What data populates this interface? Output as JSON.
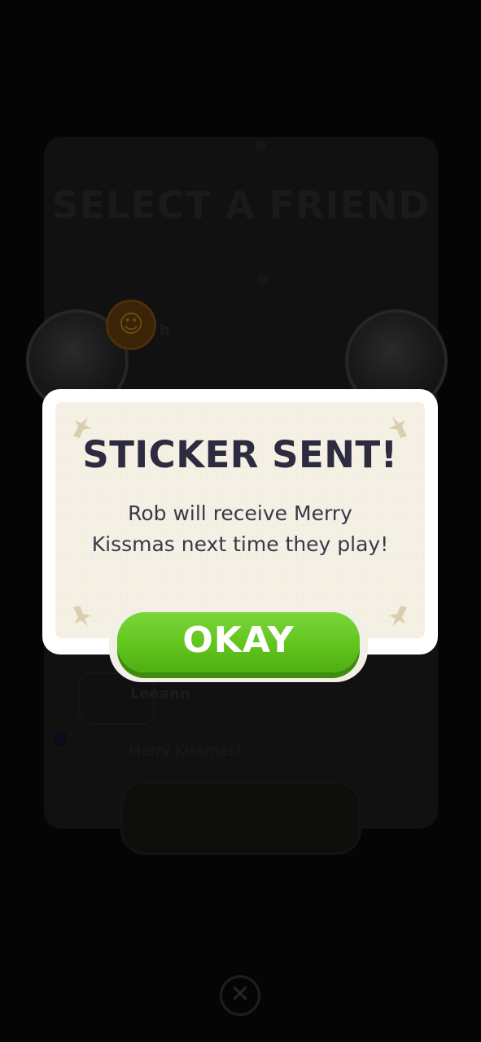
{
  "background": {
    "title": "SELECT A FRIEND",
    "friend_initial": "h",
    "friend_name": "Leeann",
    "note": "Merry Kissmas!",
    "close_symbol": "✕"
  },
  "modal": {
    "title": "STICKER SENT!",
    "message": "Rob will receive Merry Kissmas next time they play!",
    "okay_label": "OKAY"
  },
  "colors": {
    "modal_title": "#2d2b3f",
    "button_green": "#62c41e",
    "panel_cream": "#f4f0e4"
  },
  "icons": {
    "corner": "sparkle-star-icon",
    "close": "close-icon",
    "smiley": "smiley-icon"
  }
}
